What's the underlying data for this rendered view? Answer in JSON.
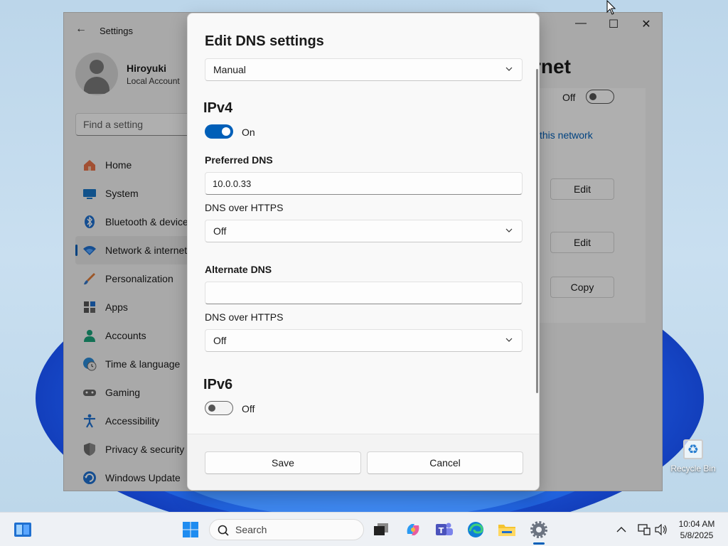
{
  "settings": {
    "window_title": "Settings",
    "profile": {
      "name": "Hiroyuki",
      "account_type": "Local Account"
    },
    "search_placeholder": "Find a setting",
    "nav_items": [
      {
        "label": "Home",
        "icon": "home-icon"
      },
      {
        "label": "System",
        "icon": "system-icon"
      },
      {
        "label": "Bluetooth & devices",
        "icon": "bluetooth-icon"
      },
      {
        "label": "Network & internet",
        "icon": "wifi-icon",
        "active": true
      },
      {
        "label": "Personalization",
        "icon": "brush-icon"
      },
      {
        "label": "Apps",
        "icon": "apps-icon"
      },
      {
        "label": "Accounts",
        "icon": "person-icon"
      },
      {
        "label": "Time & language",
        "icon": "globe-clock-icon"
      },
      {
        "label": "Gaming",
        "icon": "gamepad-icon"
      },
      {
        "label": "Accessibility",
        "icon": "accessibility-icon"
      },
      {
        "label": "Privacy & security",
        "icon": "shield-icon"
      },
      {
        "label": "Windows Update",
        "icon": "update-icon"
      }
    ],
    "right_pane": {
      "title_partial": "rnet",
      "toggle_label": "Off",
      "link_partial": "this network",
      "buttons": [
        "Edit",
        "Edit",
        "Copy"
      ]
    }
  },
  "dialog": {
    "title": "Edit DNS settings",
    "mode": "Manual",
    "ipv4": {
      "heading": "IPv4",
      "toggle_label": "On",
      "preferred_label": "Preferred DNS",
      "preferred_value": "10.0.0.33",
      "preferred_doh_label": "DNS over HTTPS",
      "preferred_doh_value": "Off",
      "alternate_label": "Alternate DNS",
      "alternate_value": "",
      "alternate_doh_label": "DNS over HTTPS",
      "alternate_doh_value": "Off"
    },
    "ipv6": {
      "heading": "IPv6",
      "toggle_label": "Off"
    },
    "save_label": "Save",
    "cancel_label": "Cancel"
  },
  "desktop": {
    "recycle_bin_label": "Recycle Bin"
  },
  "taskbar": {
    "search_placeholder": "Search",
    "time": "10:04 AM",
    "date": "5/8/2025"
  },
  "colors": {
    "accent": "#005fb8",
    "wallpaper_blue": "#1f5fd6"
  }
}
